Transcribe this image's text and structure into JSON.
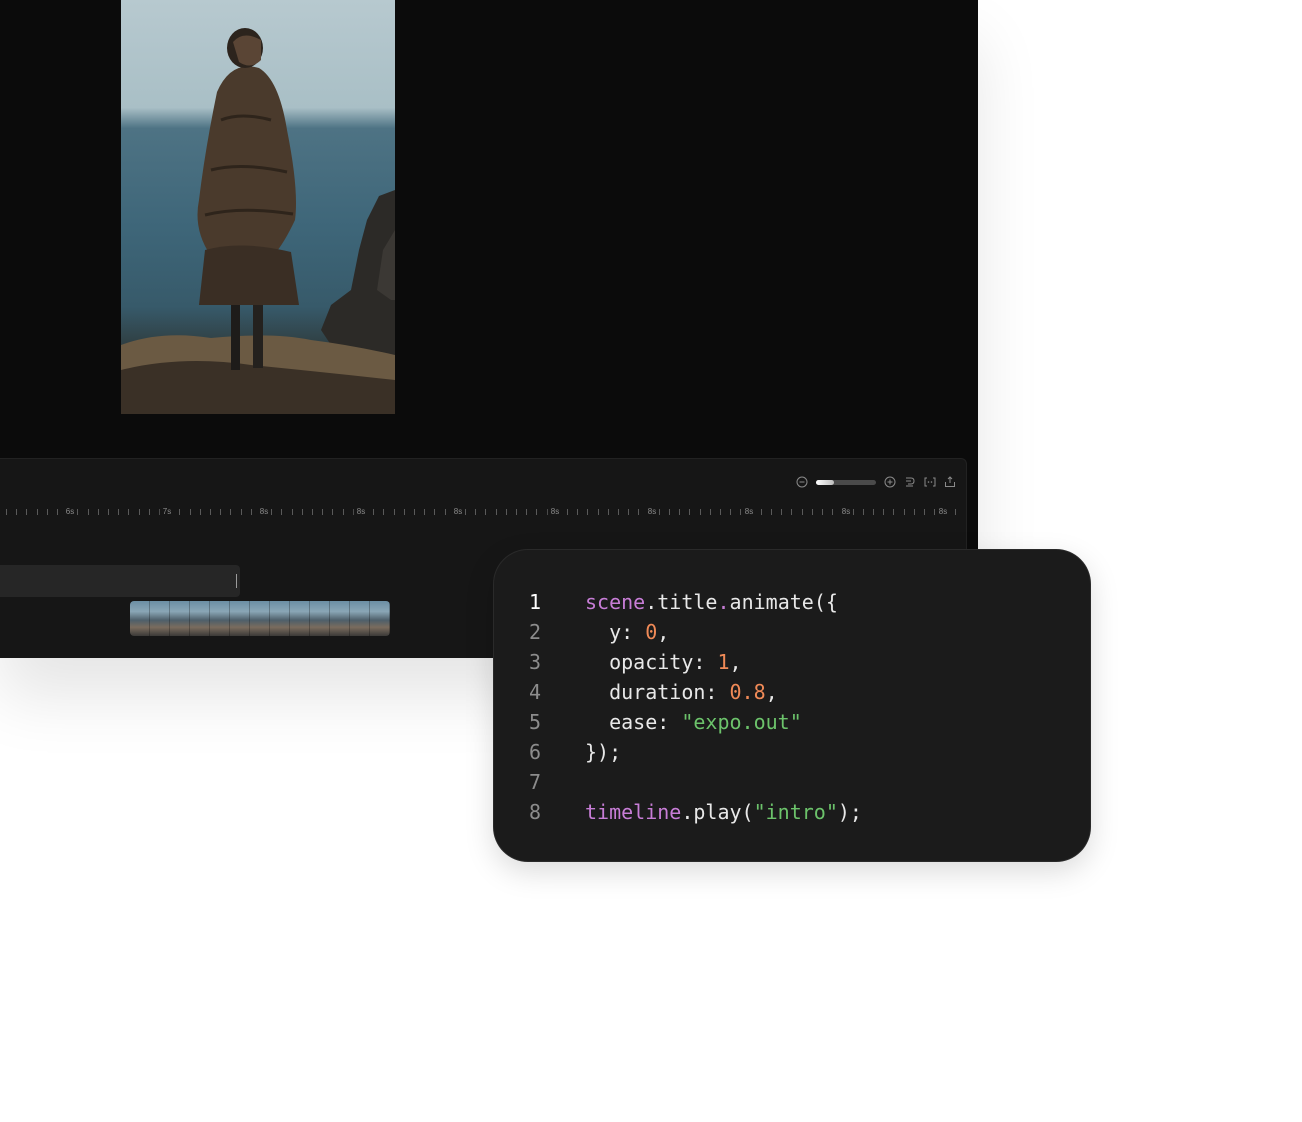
{
  "timeline": {
    "tick_labels": [
      "6s",
      "7s",
      "8s",
      "8s",
      "8s",
      "8s",
      "8s",
      "8s",
      "8s",
      "8s"
    ],
    "zoom_level": 0.3,
    "controls": [
      "zoom-out-icon",
      "zoom-in-icon",
      "snap-icon",
      "split-icon",
      "export-icon"
    ]
  },
  "code": {
    "lines": [
      {
        "num": "1",
        "tokens": [
          {
            "t": "scene",
            "k": "obj"
          },
          {
            "t": ".",
            "k": "def"
          },
          {
            "t": "title",
            "k": "def"
          },
          {
            "t": ".",
            "k": "obj"
          },
          {
            "t": "animate({",
            "k": "def"
          }
        ]
      },
      {
        "num": "2",
        "tokens": [
          {
            "t": "  y: ",
            "k": "def"
          },
          {
            "t": "0",
            "k": "num"
          },
          {
            "t": ",",
            "k": "def"
          }
        ]
      },
      {
        "num": "3",
        "tokens": [
          {
            "t": "  opacity: ",
            "k": "def"
          },
          {
            "t": "1",
            "k": "num"
          },
          {
            "t": ",",
            "k": "def"
          }
        ]
      },
      {
        "num": "4",
        "tokens": [
          {
            "t": "  duration: ",
            "k": "def"
          },
          {
            "t": "0.8",
            "k": "num"
          },
          {
            "t": ",",
            "k": "def"
          }
        ]
      },
      {
        "num": "5",
        "tokens": [
          {
            "t": "  ease: ",
            "k": "def"
          },
          {
            "t": "\"expo.out\"",
            "k": "str"
          }
        ]
      },
      {
        "num": "6",
        "tokens": [
          {
            "t": "});",
            "k": "def"
          }
        ]
      },
      {
        "num": "7",
        "tokens": []
      },
      {
        "num": "8",
        "tokens": [
          {
            "t": "timeline",
            "k": "obj"
          },
          {
            "t": ".play(",
            "k": "def"
          },
          {
            "t": "\"intro\"",
            "k": "str"
          },
          {
            "t": ");",
            "k": "def"
          }
        ]
      }
    ],
    "active_line": "1"
  },
  "colors": {
    "keyword": "#c77dd6",
    "number": "#f08a57",
    "string": "#6cc36b",
    "text": "#e8e8e8"
  }
}
